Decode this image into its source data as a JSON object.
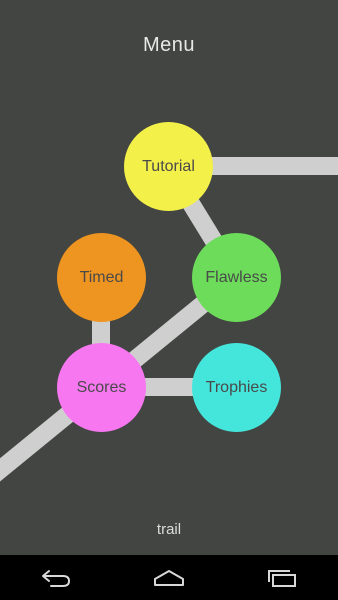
{
  "header": {
    "title": "Menu"
  },
  "nodes": {
    "tutorial": {
      "label": "Tutorial",
      "color": "#f4f04a"
    },
    "timed": {
      "label": "Timed",
      "color": "#ee9420"
    },
    "flawless": {
      "label": "Flawless",
      "color": "#6cdc5a"
    },
    "scores": {
      "label": "Scores",
      "color": "#f777f0"
    },
    "trophies": {
      "label": "Trophies",
      "color": "#44e6dc"
    }
  },
  "connector_color": "#cfcfcf",
  "footer": {
    "label": "trail"
  },
  "navbar": {
    "back": "back-icon",
    "home": "home-icon",
    "recents": "recent-apps-icon"
  }
}
